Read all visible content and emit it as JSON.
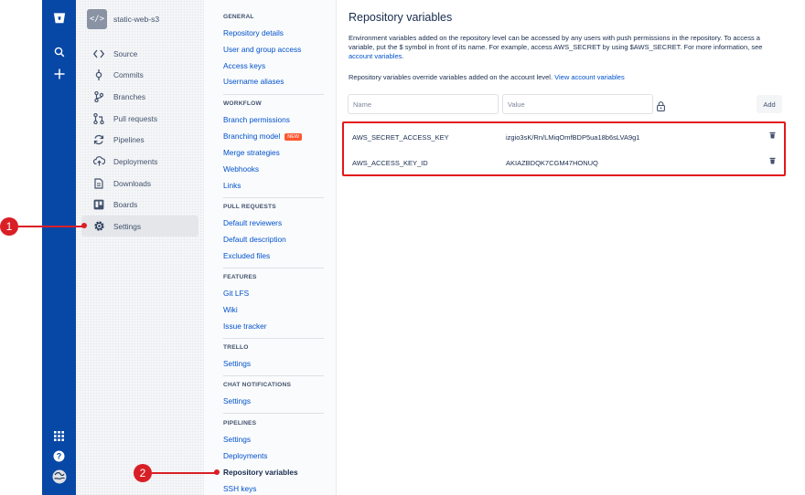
{
  "repo": {
    "name": "static-web-s3",
    "avatar_text": "</>"
  },
  "global_nav": {
    "icons": [
      "bitbucket-logo-icon",
      "search-icon",
      "plus-icon",
      "app-switcher-icon",
      "help-icon",
      "user-avatar-icon"
    ]
  },
  "sidebar": {
    "items": [
      {
        "label": "Source",
        "icon": "source-icon"
      },
      {
        "label": "Commits",
        "icon": "commits-icon"
      },
      {
        "label": "Branches",
        "icon": "branches-icon"
      },
      {
        "label": "Pull requests",
        "icon": "pull-requests-icon"
      },
      {
        "label": "Pipelines",
        "icon": "pipelines-icon"
      },
      {
        "label": "Deployments",
        "icon": "deployments-icon"
      },
      {
        "label": "Downloads",
        "icon": "downloads-icon"
      },
      {
        "label": "Boards",
        "icon": "boards-icon"
      },
      {
        "label": "Settings",
        "icon": "settings-icon",
        "active": true
      }
    ]
  },
  "settings_nav": {
    "general": {
      "heading": "GENERAL",
      "links": [
        "Repository details",
        "User and group access",
        "Access keys",
        "Username aliases"
      ]
    },
    "workflow": {
      "heading": "WORKFLOW",
      "links": [
        "Branch permissions",
        "Branching model",
        "Merge strategies",
        "Webhooks",
        "Links"
      ],
      "new_badge": "NEW"
    },
    "pull_requests": {
      "heading": "PULL REQUESTS",
      "links": [
        "Default reviewers",
        "Default description",
        "Excluded files"
      ]
    },
    "features": {
      "heading": "FEATURES",
      "links": [
        "Git LFS",
        "Wiki",
        "Issue tracker"
      ]
    },
    "trello": {
      "heading": "TRELLO",
      "links": [
        "Settings"
      ]
    },
    "chat": {
      "heading": "CHAT NOTIFICATIONS",
      "links": [
        "Settings"
      ]
    },
    "pipelines": {
      "heading": "PIPELINES",
      "links": [
        "Settings",
        "Deployments",
        "Repository variables",
        "SSH keys"
      ]
    }
  },
  "main": {
    "title": "Repository variables",
    "description_1": "Environment variables added on the repository level can be accessed by any users with push permissions in the repository. To access a variable, put the $ symbol in front of its name. For example, access AWS_SECRET by using $AWS_SECRET. For more information, see ",
    "description_link": "account variables",
    "description_end": ".",
    "note": "Repository variables override variables added on the account level. ",
    "note_link": "View account variables",
    "name_placeholder": "Name",
    "value_placeholder": "Value",
    "add_label": "Add",
    "variables": [
      {
        "key": "AWS_SECRET_ACCESS_KEY",
        "value": "izgio3sK/Rn/LMiqOmfBDP5ua18b6sLVA9g1"
      },
      {
        "key": "AWS_ACCESS_KEY_ID",
        "value": "AKIAZBDQK7CGM47HONUQ"
      }
    ]
  },
  "annotations": {
    "callout_1": "1",
    "callout_2": "2"
  },
  "colors": {
    "global_nav": "#0747a6",
    "link": "#0052cc",
    "annotation": "#d91f26",
    "badge_new": "#ff5630"
  }
}
